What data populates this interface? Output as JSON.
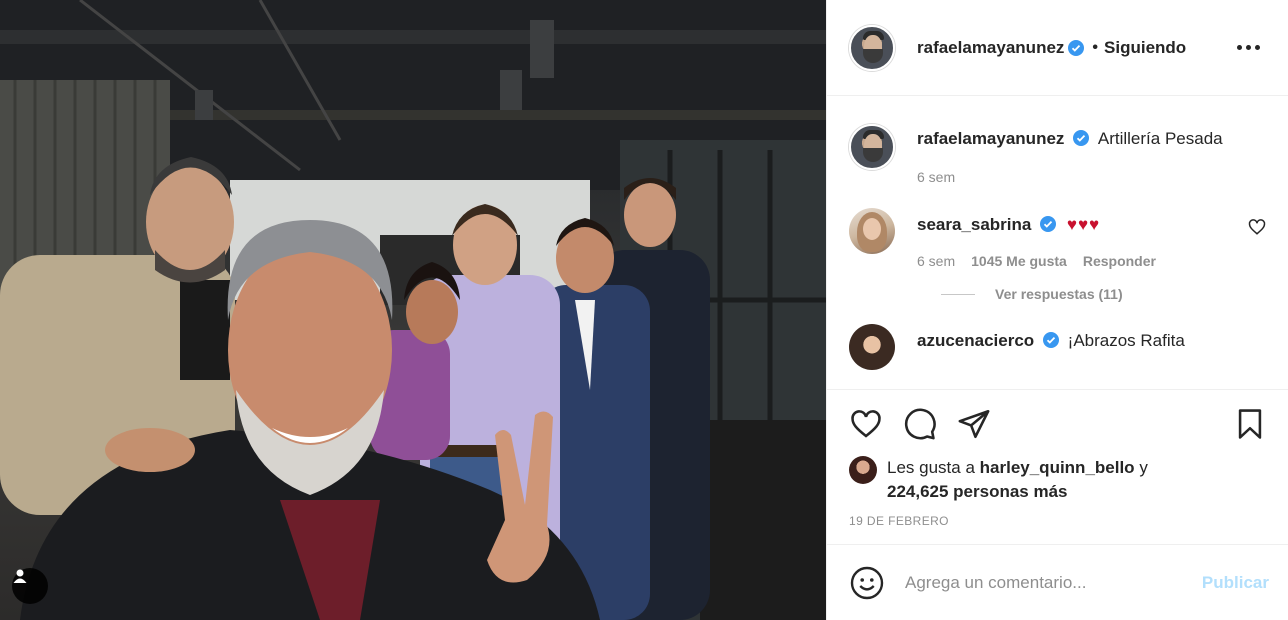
{
  "post": {
    "author": "rafaelamayanunez",
    "separator": "•",
    "follow_status": "Siguiendo",
    "more_icon": "ellipsis-icon"
  },
  "caption": {
    "username": "rafaelamayanunez",
    "text": "Artillería Pesada",
    "time": "6 sem"
  },
  "comments": [
    {
      "username": "seara_sabrina",
      "text": "♥♥♥",
      "time": "6 sem",
      "likes": "1045 Me gusta",
      "reply_label": "Responder",
      "view_replies": "Ver respuestas (11)"
    },
    {
      "username": "azucenacierco",
      "text": "¡Abrazos Rafita"
    }
  ],
  "engagement": {
    "liked_by_prefix": "Les gusta a",
    "liked_by_user": "harley_quinn_bello",
    "liked_by_mid": "y",
    "others_count": "224,625 personas más",
    "date": "19 DE FEBRERO"
  },
  "add_comment": {
    "placeholder": "Agrega un comentario...",
    "publish_label": "Publicar"
  },
  "colors": {
    "verified": "#3897f0",
    "publish_disabled": "#b2dffc",
    "secondary_text": "#8e8e8e",
    "heart_red": "#c8102e"
  }
}
